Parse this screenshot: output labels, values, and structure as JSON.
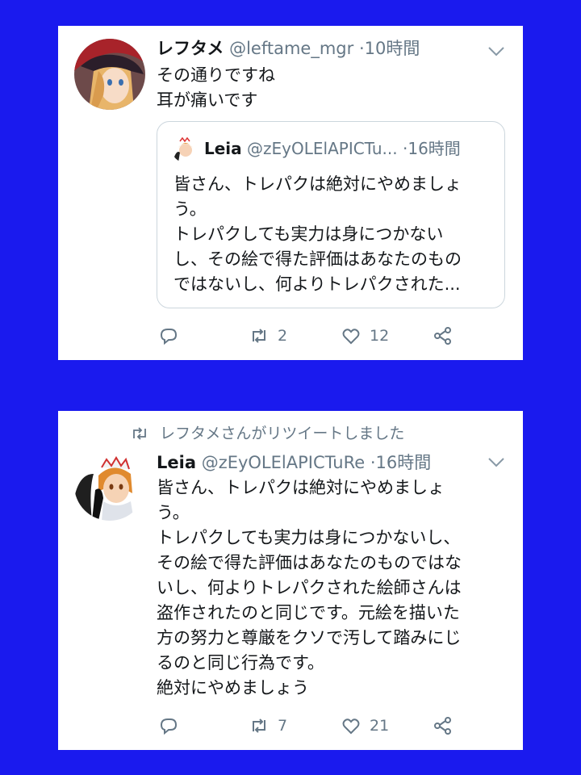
{
  "tweet1": {
    "name": "レフタメ",
    "handle": "@leftame_mgr",
    "separator": "·",
    "time": "10時間",
    "text": "その通りですね\n耳が痛いです",
    "quote": {
      "name": "Leia",
      "handle": "@zEyOLElAPICTu...",
      "separator": "·",
      "time": "16時間",
      "text": "皆さん、トレパクは絶対にやめましょ\nう。\nトレパクしても実力は身につかない\nし、その絵で得た評価はあなたのもの\nではないし、何よりトレパクされた..."
    },
    "actions": {
      "reply_count": "",
      "retweet_count": "2",
      "like_count": "12"
    }
  },
  "tweet2": {
    "retweet_notice": "レフタメさんがリツイートしました",
    "name": "Leia",
    "handle": "@zEyOLElAPICTuRe",
    "separator": "·",
    "time": "16時間",
    "text": "皆さん、トレパクは絶対にやめましょ\nう。\nトレパクしても実力は身につかないし、\nその絵で得た評価はあなたのものではな\nいし、何よりトレパクされた絵師さんは\n盗作されたのと同じです。元絵を描いた\n方の努力と尊厳をクソで汚して踏みにじ\nるのと同じ行為です。\n絶対にやめましょう",
    "actions": {
      "reply_count": "",
      "retweet_count": "7",
      "like_count": "21"
    }
  },
  "icons": [
    "reply-icon",
    "retweet-icon",
    "like-icon",
    "share-icon",
    "chevron-down-icon"
  ],
  "colors": {
    "background": "#1a1aee",
    "card": "#ffffff",
    "secondary_text": "#657786",
    "border": "#ccd6dd"
  }
}
